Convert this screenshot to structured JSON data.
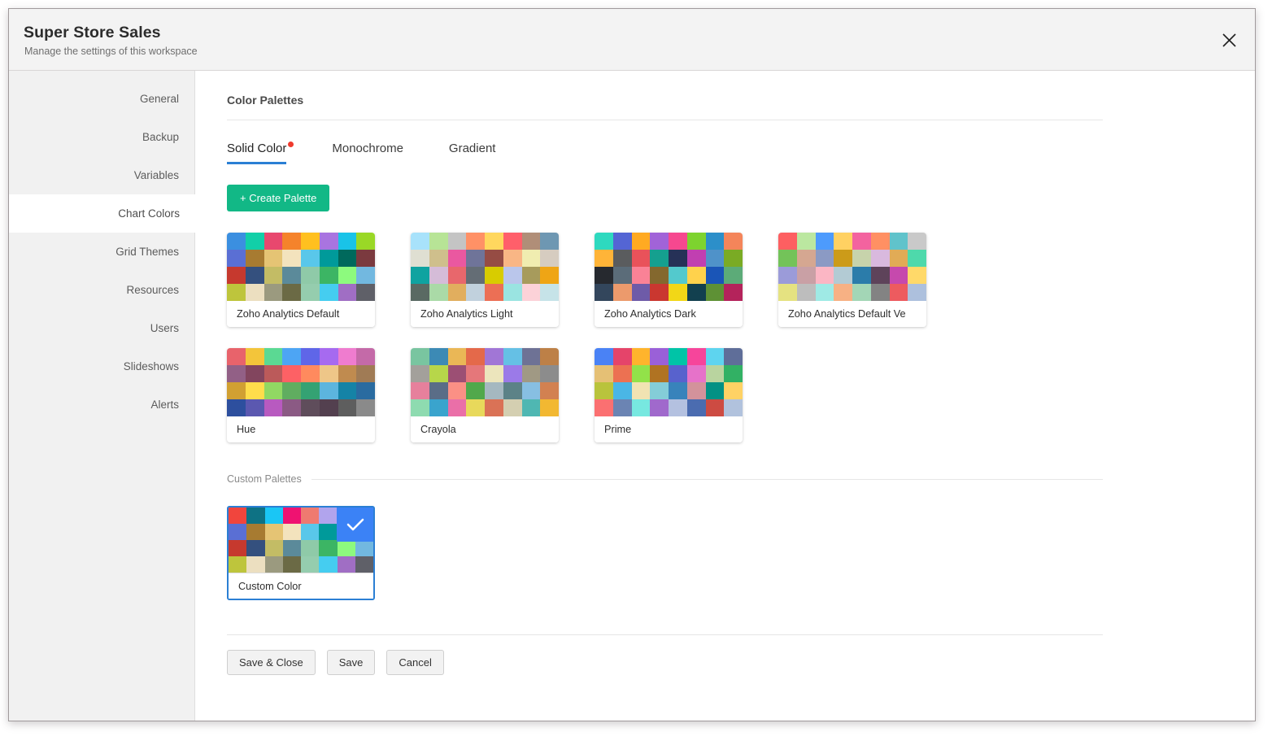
{
  "dialog": {
    "title": "Super Store Sales",
    "subtitle": "Manage the settings of this workspace",
    "close_icon": "close-icon"
  },
  "sidebar": {
    "items": [
      {
        "label": "General",
        "active": false
      },
      {
        "label": "Backup",
        "active": false
      },
      {
        "label": "Variables",
        "active": false
      },
      {
        "label": "Chart Colors",
        "active": true
      },
      {
        "label": "Grid Themes",
        "active": false
      },
      {
        "label": "Resources",
        "active": false
      },
      {
        "label": "Users",
        "active": false
      },
      {
        "label": "Slideshows",
        "active": false
      },
      {
        "label": "Alerts",
        "active": false
      }
    ]
  },
  "main": {
    "section_title": "Color Palettes",
    "tabs": [
      {
        "label": "Solid Color",
        "active": true,
        "dot": true
      },
      {
        "label": "Monochrome",
        "active": false,
        "dot": false
      },
      {
        "label": "Gradient",
        "active": false,
        "dot": false
      }
    ],
    "create_button": "+ Create Palette",
    "custom_section_label": "Custom Palettes",
    "accent_color": "#2b7fd4",
    "create_button_color": "#12b886",
    "dot_color": "#ef3a2d",
    "selected_color": "#3b82f6"
  },
  "palettes": [
    {
      "name": "Zoho Analytics Default",
      "selected": false,
      "colors": [
        "#3b8fe0",
        "#12cfa8",
        "#e8486e",
        "#f5832b",
        "#ffc01f",
        "#a974e0",
        "#19c3e8",
        "#9ad826",
        "#5a6fd4",
        "#a77b31",
        "#e5c474",
        "#f3e3bd",
        "#59c7ea",
        "#009a9a",
        "#00695c",
        "#7b3a3f",
        "#c6392e",
        "#34507e",
        "#c3bc65",
        "#5b8a9a",
        "#8fcaa8",
        "#3cb564",
        "#8dfa7e",
        "#72b8e0",
        "#bec53c",
        "#ecdfc0",
        "#9b9a7f",
        "#6b6a45",
        "#95cdae",
        "#45cdf0",
        "#a06ec4",
        "#5f6068"
      ]
    },
    {
      "name": "Zoho Analytics Light",
      "selected": false,
      "colors": [
        "#a8e2fb",
        "#b7e496",
        "#c4c4c4",
        "#ff9166",
        "#ffd75e",
        "#ff5f6a",
        "#b08e78",
        "#6e97b2",
        "#dfdfd2",
        "#cfbf8c",
        "#ea58a0",
        "#6f7499",
        "#964c44",
        "#f9b685",
        "#f0edb0",
        "#d6ccc0",
        "#0fa3a0",
        "#d5bcd8",
        "#e8676c",
        "#646d75",
        "#d8cc00",
        "#bac6eb",
        "#a79b5c",
        "#efa515",
        "#5a6a63",
        "#aadaa7",
        "#e1ae5e",
        "#c1d1dd",
        "#ec6f55",
        "#9ae4e1",
        "#fcd2d8",
        "#c6e3e8"
      ]
    },
    {
      "name": "Zoho Analytics Dark",
      "selected": false,
      "colors": [
        "#2ed9bf",
        "#5465d4",
        "#ffaa22",
        "#a163d8",
        "#f6488f",
        "#7dd32f",
        "#2c8fc9",
        "#f4855a",
        "#ffb438",
        "#5a5c5e",
        "#e9525a",
        "#15a08f",
        "#263157",
        "#c13fb1",
        "#4f92c9",
        "#7aab24",
        "#26292f",
        "#5b6c79",
        "#fa8296",
        "#84682e",
        "#53c9cd",
        "#ffd24c",
        "#1a55b7",
        "#5cab78",
        "#33465c",
        "#ec9a6c",
        "#6e5ba8",
        "#ca3730",
        "#f2d717",
        "#12404f",
        "#5e9135",
        "#b4235b"
      ]
    },
    {
      "name": "Zoho Analytics Default Ve",
      "selected": false,
      "colors": [
        "#fd5f61",
        "#bbe7a0",
        "#4d9bfd",
        "#ffd162",
        "#f3639f",
        "#ff9063",
        "#60c3cb",
        "#c9c9c9",
        "#73c359",
        "#d5a791",
        "#8b9ac4",
        "#cc9b19",
        "#c7d3ab",
        "#d9b9de",
        "#e1ab56",
        "#4ed9ab",
        "#9b9bd9",
        "#c9a0a5",
        "#fbb6c4",
        "#b3cbd4",
        "#2b7caa",
        "#5e435a",
        "#c649ad",
        "#ffd969",
        "#e5e281",
        "#bdbdbd",
        "#9feae5",
        "#f7b184",
        "#a3d6b6",
        "#838383",
        "#ed5b5f",
        "#adc0dd"
      ]
    },
    {
      "name": "Hue",
      "selected": false,
      "colors": [
        "#e8636b",
        "#f3c53a",
        "#5bd993",
        "#4da5f4",
        "#5f66e8",
        "#a66af0",
        "#ef7ccf",
        "#c46aa8",
        "#926086",
        "#82455e",
        "#bb5a5a",
        "#fd6165",
        "#ff8a5e",
        "#eec688",
        "#c08b4f",
        "#a07b55",
        "#d1a032",
        "#ffdd4b",
        "#91d863",
        "#60ad60",
        "#34a273",
        "#5cb5de",
        "#1583a6",
        "#2a6ba0",
        "#2d4f9e",
        "#5b58b0",
        "#b85ac0",
        "#8b5a84",
        "#5f4d5b",
        "#53404f",
        "#5e5e5e",
        "#8a8a8a"
      ]
    },
    {
      "name": "Crayola",
      "selected": false,
      "colors": [
        "#79c5a0",
        "#3c8ab5",
        "#eab756",
        "#e4694a",
        "#a176d6",
        "#65c0e5",
        "#6e7295",
        "#bd8047",
        "#a3a09b",
        "#b7d64a",
        "#9c4f74",
        "#e5777a",
        "#ece5bc",
        "#9b7ae8",
        "#a09984",
        "#8c8c8c",
        "#e6809c",
        "#5a6d87",
        "#fb9085",
        "#51a84b",
        "#a5b8c0",
        "#5c8287",
        "#87bfe2",
        "#d28151",
        "#8edbb0",
        "#3aa4cd",
        "#ea6fa8",
        "#e8d95b",
        "#da7256",
        "#d4cfb1",
        "#4fb7b2",
        "#f2b832"
      ]
    },
    {
      "name": "Prime",
      "selected": false,
      "colors": [
        "#4a82f5",
        "#e5446a",
        "#ffb42c",
        "#9a60d8",
        "#00c4a7",
        "#f6459b",
        "#5ed4ef",
        "#5f6e99",
        "#e5c075",
        "#ec7152",
        "#92e249",
        "#b07322",
        "#5862cd",
        "#e672c9",
        "#b9d49f",
        "#32b164",
        "#b9c33c",
        "#4ab6e5",
        "#f1e3b2",
        "#84cdd8",
        "#3883bb",
        "#d3929b",
        "#029184",
        "#ffd264",
        "#fb7071",
        "#6b84b3",
        "#77e8e0",
        "#a069cc",
        "#b4c1e0",
        "#4b6cb0",
        "#cd4b42",
        "#b1c2dd"
      ]
    }
  ],
  "custom_palettes": [
    {
      "name": "Custom Color",
      "selected": true,
      "colors": [
        "#f1453d",
        "#0e7284",
        "#1ac6f5",
        "#ef1271",
        "#ef7a70",
        "#b1a4ed",
        "#0cb6e8",
        "#3b82f6",
        "#5a6fd4",
        "#a77b31",
        "#e5c474",
        "#f3e3bd",
        "#59c7ea",
        "#009a9a",
        "#00695c",
        "#7b3a3f",
        "#c6392e",
        "#34507e",
        "#c3bc65",
        "#5b8a9a",
        "#8fcaa8",
        "#3cb564",
        "#8dfa7e",
        "#72b8e0",
        "#bec53c",
        "#ecdfc0",
        "#9b9a7f",
        "#6b6a45",
        "#95cdae",
        "#45cdf0",
        "#a06ec4",
        "#5f6068"
      ]
    }
  ],
  "footer": {
    "buttons": [
      {
        "label": "Save & Close"
      },
      {
        "label": "Save"
      },
      {
        "label": "Cancel"
      }
    ]
  }
}
